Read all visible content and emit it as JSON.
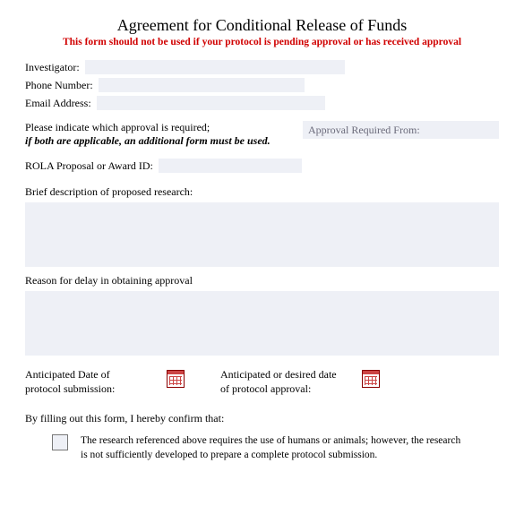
{
  "title": "Agreement for Conditional Release of Funds",
  "warning": "This form should not be used if your protocol is pending approval or has received approval",
  "investigator": {
    "label": "Investigator:",
    "value": ""
  },
  "phone": {
    "label": "Phone Number:",
    "value": ""
  },
  "email": {
    "label": "Email Address:",
    "value": ""
  },
  "approval": {
    "line1": "Please indicate which approval is required;",
    "line2": "if both are applicable,  an additional form must be used.",
    "box": "Approval Required From:"
  },
  "rola": {
    "label": "ROLA Proposal or Award ID:",
    "value": ""
  },
  "brief": {
    "label": "Brief description of proposed research:",
    "value": ""
  },
  "reason": {
    "label": "Reason for delay in obtaining approval",
    "value": ""
  },
  "date1": {
    "line1": "Anticipated Date of",
    "line2": "protocol submission:"
  },
  "date2": {
    "line1": "Anticipated or desired date",
    "line2": "of protocol approval:"
  },
  "confirm": "By filling out this form, I hereby confirm that:",
  "check1": "The research referenced above requires the use of humans or animals; however, the research is not sufficiently developed to prepare a complete protocol submission."
}
